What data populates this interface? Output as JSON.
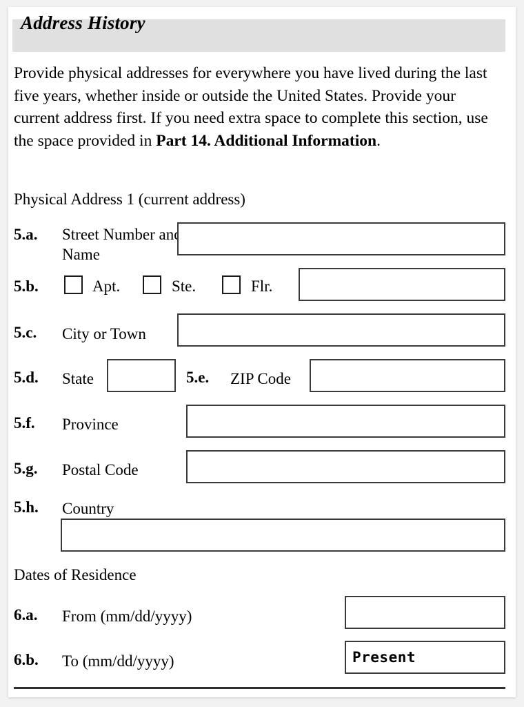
{
  "section": {
    "title": "Address History",
    "intro_line1": "Provide physical addresses for everywhere you have lived",
    "intro_line2": "during the last five years, whether inside or outside the United",
    "intro_line3": "States.  Provide your current address first.  If you need extra",
    "intro_line4": "space to complete this section, use the space provided in",
    "intro_bold": "Part 14. Additional Information",
    "intro_period": ".",
    "band_color": "#e0e0e0"
  },
  "address_block": {
    "heading": "Physical Address 1 (current address)",
    "rows": [
      {
        "number": "5.a.",
        "label": "Street Number and Name",
        "value": ""
      },
      {
        "number": "5.b.",
        "label": "",
        "value": ""
      },
      {
        "number": "5.c.",
        "label": "City or Town",
        "value": ""
      },
      {
        "number": "5.d.",
        "label": "State",
        "value": ""
      },
      {
        "number": "5.e.",
        "label": "ZIP Code",
        "value": ""
      },
      {
        "number": "5.f.",
        "label": "Province",
        "value": ""
      },
      {
        "number": "5.g.",
        "label": "Postal Code",
        "value": ""
      },
      {
        "number": "5.h.",
        "label": "Country",
        "value": ""
      }
    ],
    "unit_checkboxes": [
      {
        "label": "Apt.",
        "checked": false
      },
      {
        "label": "Ste.",
        "checked": false
      },
      {
        "label": "Flr.",
        "checked": false
      }
    ]
  },
  "dates_block": {
    "heading": "Dates of Residence",
    "rows": [
      {
        "number": "6.a.",
        "label": "From (mm/dd/yyyy)",
        "value": ""
      },
      {
        "number": "6.b.",
        "label": "To (mm/dd/yyyy)",
        "value": "Present"
      }
    ]
  }
}
